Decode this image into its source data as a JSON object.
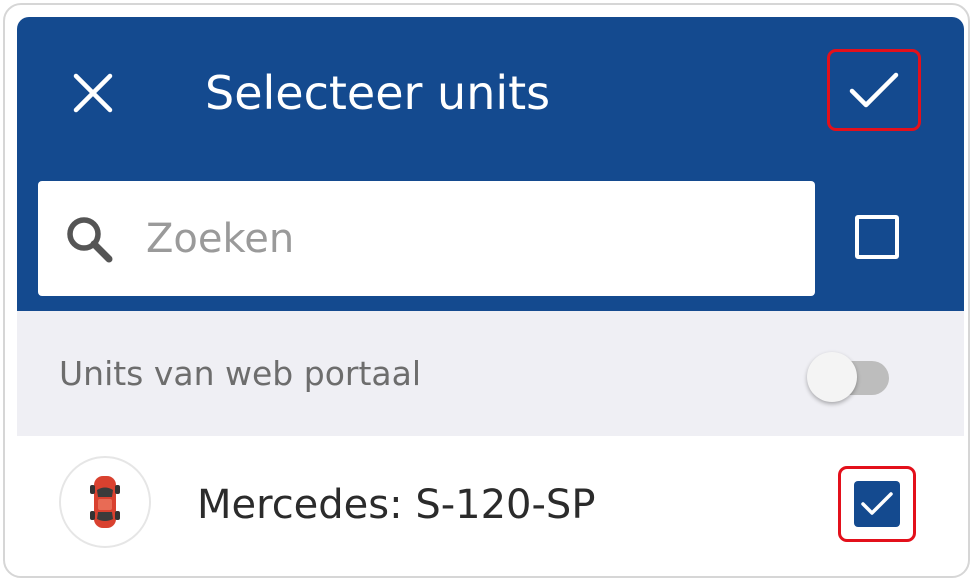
{
  "header": {
    "title": "Selecteer units",
    "close_icon": "close-icon",
    "confirm_icon": "check-icon",
    "background_color": "#144a8f"
  },
  "search": {
    "placeholder": "Zoeken",
    "value": "",
    "icon": "search-icon"
  },
  "select_all": {
    "checked": false
  },
  "portal_units": {
    "label": "Units van web portaal",
    "toggle_on": false
  },
  "units": [
    {
      "name": "Mercedes: S-120-SP",
      "icon": "car-icon",
      "checked": true
    }
  ],
  "colors": {
    "highlight": "#e3101b",
    "accent": "#144a8f"
  }
}
